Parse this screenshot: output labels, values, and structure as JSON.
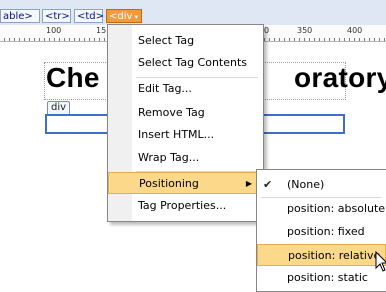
{
  "tag_selector": {
    "tags": [
      "able>",
      "<tr>",
      "<td>",
      "<div"
    ],
    "active_caret": "▾"
  },
  "ruler": {
    "labels": [
      "100",
      "15",
      "0",
      "350",
      "400"
    ]
  },
  "page": {
    "heading_left": "Che",
    "heading_right": "oratory",
    "div_label": "div"
  },
  "context_menu": {
    "items": [
      {
        "label": "Select Tag"
      },
      {
        "label": "Select Tag Contents"
      },
      {
        "label": "Edit Tag..."
      },
      {
        "label": "Remove Tag"
      },
      {
        "label": "Insert HTML..."
      },
      {
        "label": "Wrap Tag..."
      },
      {
        "label": "Positioning"
      },
      {
        "label": "Tag Properties..."
      }
    ],
    "submenu_arrow": "▶"
  },
  "positioning_submenu": {
    "items": [
      {
        "label": "(None)"
      },
      {
        "label": "position: absolute"
      },
      {
        "label": "position: fixed"
      },
      {
        "label": "position: relative"
      },
      {
        "label": "position: static"
      }
    ],
    "check": "✔"
  }
}
